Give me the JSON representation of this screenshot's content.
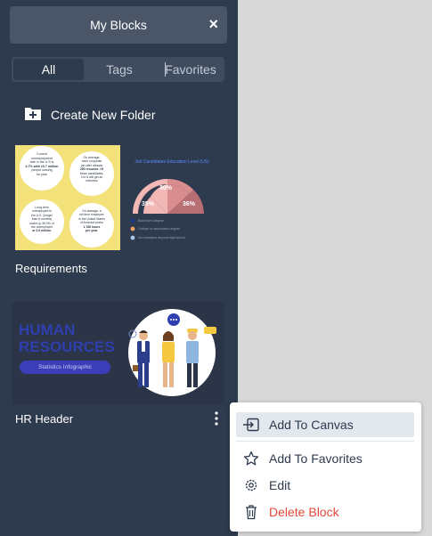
{
  "panel": {
    "title": "My Blocks",
    "close_icon": "close-icon"
  },
  "tabs": [
    {
      "label": "All",
      "active": true
    },
    {
      "label": "Tags",
      "active": false
    },
    {
      "label": "Favorites",
      "active": false
    }
  ],
  "new_folder": {
    "label": "Create New Folder",
    "icon": "folder-plus-icon"
  },
  "blocks": [
    {
      "name": "Requirements",
      "thumbnail": {
        "circles": [
          {
            "lines": [
              "Current",
              "unemployment",
              "rate in the U.S is",
              "6.7% with 10.7 million",
              "people looking",
              "for jobs"
            ]
          },
          {
            "lines": [
              "On average,",
              "each corporate",
              "job offer attracts",
              "250 resumes. Of",
              "those candidates,",
              "4 to 6 will get an",
              "interview"
            ]
          },
          {
            "lines": [
              "Long-term",
              "unemployed in",
              "the U.S. (longer",
              "than 6 months)",
              "make up 36.9% of",
              "the unemployed",
              "or 3.9 million."
            ]
          },
          {
            "lines": [
              "On average, a",
              "full time employee",
              "in the United States",
              "of America works",
              "1,786 hours",
              "per year."
            ]
          }
        ],
        "chart_heading": "Job Candidates Education Level (US)",
        "pie_labels": [
          "30%",
          "35%",
          "36%"
        ],
        "legend": [
          "Bachelor's degree",
          "College or associate's degree",
          "No education beyond high school"
        ],
        "colors": {
          "bg": "#f3e27a",
          "pie_light": "#f2b8b5",
          "pie_mid": "#d98d8e",
          "pie_dark": "#b86f74",
          "legend_1": "#1f3b8c",
          "legend_2": "#f0a35e",
          "legend_3": "#a9c8e8"
        }
      }
    },
    {
      "name": "HR Header",
      "thumbnail": {
        "title_line1": "HUMAN",
        "title_line2": "RESOURCES",
        "subtitle": "Statistics Infographic",
        "colors": {
          "bg": "#2b3547",
          "title": "#2f3fb0",
          "pill": "#3b3db9"
        }
      },
      "more_icon": "more-vertical-icon"
    }
  ],
  "context_menu": {
    "items": [
      {
        "label": "Add To Canvas",
        "icon": "add-to-canvas-icon",
        "highlighted": true
      },
      {
        "label": "Add To Favorites",
        "icon": "star-icon",
        "highlighted": false
      },
      {
        "label": "Edit",
        "icon": "gear-icon",
        "highlighted": false
      },
      {
        "label": "Delete Block",
        "icon": "trash-icon",
        "highlighted": false,
        "danger": true
      }
    ]
  }
}
